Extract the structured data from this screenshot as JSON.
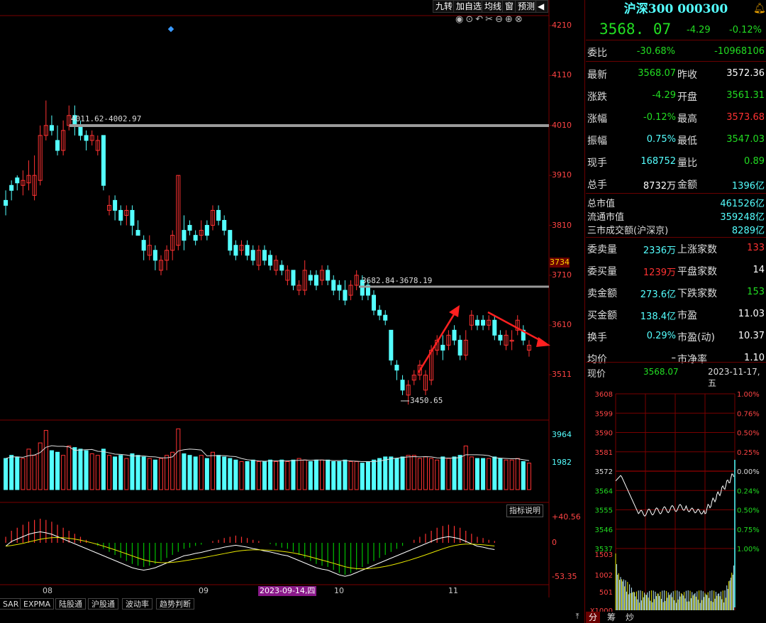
{
  "toolbar": {
    "buttons": [
      "九转",
      "加自选",
      "均线",
      "窗",
      "预测"
    ]
  },
  "colors": {
    "up": "#ff3232",
    "down": "#54ffff",
    "gray_line": "#9a9a9a",
    "yellow": "#e8e800",
    "white": "#ffffff",
    "green": "#00dd00",
    "cyan_text": "#54ffff",
    "grid": "#7a0000"
  },
  "kline": {
    "price_axis": [
      "4210",
      "4110",
      "4010",
      "3910",
      "3810",
      "3734",
      "3710",
      "3610",
      "3511"
    ],
    "current_price_tag": "3734",
    "annotations": {
      "range1": "4011.62-4002.97",
      "range2": "3682.84-3678.19",
      "low": "3450.65"
    },
    "volume_axis": [
      "3964",
      "1982"
    ],
    "macd_axis": [
      "+40.56",
      "0",
      "-53.35"
    ],
    "indicator_button": "指标说明",
    "date_labels": [
      "08",
      "09",
      "10",
      "11"
    ],
    "highlight_date": "2023-09-14,四",
    "bottom_tabs": [
      "SAR",
      "EXPMA",
      "陆股通",
      "沪股通",
      "波动率",
      "趋势判断"
    ]
  },
  "chart_data": {
    "type": "candlestick",
    "title": "沪深300 000300",
    "ylim": [
      3420,
      4230
    ],
    "candles": [
      {
        "o": 3860,
        "c": 3850,
        "h": 3880,
        "l": 3830
      },
      {
        "o": 3890,
        "c": 3880,
        "h": 3900,
        "l": 3860
      },
      {
        "o": 3905,
        "c": 3895,
        "h": 3910,
        "l": 3880
      },
      {
        "o": 3890,
        "c": 3900,
        "h": 3920,
        "l": 3870
      },
      {
        "o": 3895,
        "c": 3910,
        "h": 3940,
        "l": 3880
      },
      {
        "o": 3870,
        "c": 3910,
        "h": 3950,
        "l": 3860
      },
      {
        "o": 3900,
        "c": 3990,
        "h": 4010,
        "l": 3890
      },
      {
        "o": 3990,
        "c": 4010,
        "h": 4060,
        "l": 3980
      },
      {
        "o": 4010,
        "c": 4000,
        "h": 4030,
        "l": 3990
      },
      {
        "o": 3980,
        "c": 3960,
        "h": 4010,
        "l": 3950
      },
      {
        "o": 3960,
        "c": 4000,
        "h": 4020,
        "l": 3950
      },
      {
        "o": 4010,
        "c": 4030,
        "h": 4050,
        "l": 4000
      },
      {
        "o": 4030,
        "c": 4010,
        "h": 4050,
        "l": 3990
      },
      {
        "o": 4010,
        "c": 3990,
        "h": 4020,
        "l": 3980
      },
      {
        "o": 3990,
        "c": 3980,
        "h": 4000,
        "l": 3960
      },
      {
        "o": 3980,
        "c": 3990,
        "h": 4000,
        "l": 3970
      },
      {
        "o": 3960,
        "c": 3980,
        "h": 3990,
        "l": 3950
      },
      {
        "o": 3990,
        "c": 3890,
        "h": 3990,
        "l": 3880
      },
      {
        "o": 3840,
        "c": 3850,
        "h": 3870,
        "l": 3830
      },
      {
        "o": 3860,
        "c": 3840,
        "h": 3870,
        "l": 3820
      },
      {
        "o": 3840,
        "c": 3820,
        "h": 3850,
        "l": 3810
      },
      {
        "o": 3830,
        "c": 3840,
        "h": 3850,
        "l": 3810
      },
      {
        "o": 3840,
        "c": 3810,
        "h": 3850,
        "l": 3790
      },
      {
        "o": 3800,
        "c": 3790,
        "h": 3820,
        "l": 3790
      },
      {
        "o": 3780,
        "c": 3760,
        "h": 3790,
        "l": 3740
      },
      {
        "o": 3750,
        "c": 3770,
        "h": 3790,
        "l": 3740
      },
      {
        "o": 3760,
        "c": 3740,
        "h": 3770,
        "l": 3720
      },
      {
        "o": 3720,
        "c": 3740,
        "h": 3750,
        "l": 3710
      },
      {
        "o": 3740,
        "c": 3760,
        "h": 3770,
        "l": 3720
      },
      {
        "o": 3760,
        "c": 3790,
        "h": 3800,
        "l": 3740
      },
      {
        "o": 3770,
        "c": 3910,
        "h": 3910,
        "l": 3760
      },
      {
        "o": 3800,
        "c": 3780,
        "h": 3830,
        "l": 3760
      },
      {
        "o": 3810,
        "c": 3800,
        "h": 3820,
        "l": 3790
      },
      {
        "o": 3790,
        "c": 3780,
        "h": 3800,
        "l": 3770
      },
      {
        "o": 3790,
        "c": 3800,
        "h": 3820,
        "l": 3780
      },
      {
        "o": 3810,
        "c": 3790,
        "h": 3820,
        "l": 3780
      },
      {
        "o": 3810,
        "c": 3840,
        "h": 3850,
        "l": 3800
      },
      {
        "o": 3840,
        "c": 3820,
        "h": 3850,
        "l": 3810
      },
      {
        "o": 3820,
        "c": 3800,
        "h": 3830,
        "l": 3790
      },
      {
        "o": 3800,
        "c": 3760,
        "h": 3800,
        "l": 3750
      },
      {
        "o": 3770,
        "c": 3750,
        "h": 3780,
        "l": 3740
      },
      {
        "o": 3760,
        "c": 3770,
        "h": 3780,
        "l": 3750
      },
      {
        "o": 3770,
        "c": 3750,
        "h": 3780,
        "l": 3740
      },
      {
        "o": 3760,
        "c": 3740,
        "h": 3770,
        "l": 3730
      },
      {
        "o": 3730,
        "c": 3760,
        "h": 3770,
        "l": 3720
      },
      {
        "o": 3760,
        "c": 3740,
        "h": 3770,
        "l": 3730
      },
      {
        "o": 3750,
        "c": 3730,
        "h": 3760,
        "l": 3720
      },
      {
        "o": 3720,
        "c": 3740,
        "h": 3750,
        "l": 3710
      },
      {
        "o": 3730,
        "c": 3720,
        "h": 3740,
        "l": 3710
      },
      {
        "o": 3700,
        "c": 3720,
        "h": 3730,
        "l": 3690
      },
      {
        "o": 3720,
        "c": 3690,
        "h": 3720,
        "l": 3680
      },
      {
        "o": 3680,
        "c": 3690,
        "h": 3700,
        "l": 3670
      },
      {
        "o": 3680,
        "c": 3720,
        "h": 3740,
        "l": 3670
      },
      {
        "o": 3710,
        "c": 3700,
        "h": 3720,
        "l": 3690
      },
      {
        "o": 3710,
        "c": 3690,
        "h": 3720,
        "l": 3680
      },
      {
        "o": 3700,
        "c": 3720,
        "h": 3730,
        "l": 3690
      },
      {
        "o": 3720,
        "c": 3700,
        "h": 3730,
        "l": 3690
      },
      {
        "o": 3700,
        "c": 3680,
        "h": 3710,
        "l": 3670
      },
      {
        "o": 3690,
        "c": 3680,
        "h": 3700,
        "l": 3660
      },
      {
        "o": 3680,
        "c": 3660,
        "h": 3700,
        "l": 3650
      },
      {
        "o": 3670,
        "c": 3690,
        "h": 3700,
        "l": 3660
      },
      {
        "o": 3690,
        "c": 3710,
        "h": 3720,
        "l": 3680
      },
      {
        "o": 3700,
        "c": 3670,
        "h": 3710,
        "l": 3660
      },
      {
        "o": 3690,
        "c": 3670,
        "h": 3700,
        "l": 3660
      },
      {
        "o": 3670,
        "c": 3640,
        "h": 3680,
        "l": 3630
      },
      {
        "o": 3640,
        "c": 3630,
        "h": 3650,
        "l": 3620
      },
      {
        "o": 3630,
        "c": 3620,
        "h": 3640,
        "l": 3610
      },
      {
        "o": 3600,
        "c": 3540,
        "h": 3600,
        "l": 3530
      },
      {
        "o": 3530,
        "c": 3520,
        "h": 3540,
        "l": 3500
      },
      {
        "o": 3500,
        "c": 3480,
        "h": 3510,
        "l": 3470
      },
      {
        "o": 3470,
        "c": 3490,
        "h": 3500,
        "l": 3451
      },
      {
        "o": 3500,
        "c": 3510,
        "h": 3520,
        "l": 3490
      },
      {
        "o": 3510,
        "c": 3530,
        "h": 3540,
        "l": 3500
      },
      {
        "o": 3480,
        "c": 3510,
        "h": 3520,
        "l": 3470
      },
      {
        "o": 3500,
        "c": 3560,
        "h": 3570,
        "l": 3490
      },
      {
        "o": 3560,
        "c": 3580,
        "h": 3590,
        "l": 3550
      },
      {
        "o": 3570,
        "c": 3560,
        "h": 3590,
        "l": 3540
      },
      {
        "o": 3570,
        "c": 3590,
        "h": 3600,
        "l": 3560
      },
      {
        "o": 3600,
        "c": 3580,
        "h": 3610,
        "l": 3570
      },
      {
        "o": 3580,
        "c": 3550,
        "h": 3590,
        "l": 3540
      },
      {
        "o": 3550,
        "c": 3580,
        "h": 3600,
        "l": 3540
      },
      {
        "o": 3610,
        "c": 3630,
        "h": 3640,
        "l": 3600
      },
      {
        "o": 3620,
        "c": 3610,
        "h": 3630,
        "l": 3600
      },
      {
        "o": 3620,
        "c": 3610,
        "h": 3630,
        "l": 3600
      },
      {
        "o": 3610,
        "c": 3620,
        "h": 3630,
        "l": 3600
      },
      {
        "o": 3620,
        "c": 3590,
        "h": 3630,
        "l": 3580
      },
      {
        "o": 3590,
        "c": 3580,
        "h": 3600,
        "l": 3570
      },
      {
        "o": 3570,
        "c": 3590,
        "h": 3600,
        "l": 3560
      },
      {
        "o": 3580,
        "c": 3580,
        "h": 3600,
        "l": 3560
      },
      {
        "o": 3600,
        "c": 3620,
        "h": 3630,
        "l": 3590
      },
      {
        "o": 3600,
        "c": 3580,
        "h": 3610,
        "l": 3570
      },
      {
        "o": 3560,
        "c": 3570,
        "h": 3580,
        "l": 3547
      }
    ],
    "volumes": [
      2000,
      2200,
      2100,
      2000,
      2600,
      2200,
      3000,
      3800,
      2500,
      2400,
      2200,
      2800,
      2700,
      2600,
      2500,
      2300,
      2200,
      2600,
      2200,
      2100,
      2200,
      2000,
      2300,
      2200,
      2100,
      2000,
      1900,
      2000,
      2200,
      2400,
      3900,
      2300,
      2200,
      2100,
      2200,
      2000,
      2400,
      2200,
      2100,
      2000,
      1900,
      1800,
      1800,
      1900,
      1800,
      1800,
      1900,
      1800,
      1900,
      1800,
      1900,
      2000,
      1900,
      1800,
      1900,
      1900,
      1900,
      1800,
      1800,
      1900,
      1800,
      1800,
      1700,
      1800,
      1900,
      2000,
      2100,
      2100,
      2000,
      2100,
      2200,
      2200,
      2000,
      2100,
      2000,
      1900,
      2100,
      2000,
      2100,
      2200,
      2800,
      2100,
      2000,
      2000,
      2000,
      2100,
      2000,
      1900,
      1900,
      2000,
      1800,
      1700
    ],
    "macd_hist": [
      10,
      20,
      25,
      30,
      35,
      38,
      40,
      38,
      35,
      30,
      25,
      20,
      15,
      10,
      5,
      0,
      -5,
      -10,
      -15,
      -20,
      -25,
      -30,
      -35,
      -38,
      -40,
      -38,
      -35,
      -30,
      -25,
      -20,
      -15,
      -10,
      -8,
      -5,
      -3,
      0,
      3,
      5,
      8,
      10,
      12,
      10,
      8,
      5,
      3,
      0,
      -2,
      -5,
      -8,
      -10,
      -15,
      -20,
      -25,
      -30,
      -35,
      -38,
      -40,
      -45,
      -50,
      -53,
      -50,
      -45,
      -40,
      -35,
      -30,
      -25,
      -20,
      -15,
      -10,
      -5,
      0,
      5,
      10,
      15,
      20,
      25,
      28,
      30,
      28,
      25,
      20,
      15,
      10,
      8,
      5,
      3
    ],
    "current_price": "3568.07",
    "prev_close": "3572.36"
  },
  "right_panel": {
    "title": "沪深300 000300",
    "price": "3568. 07",
    "change": "-4.29",
    "change_pct": "-0.12%",
    "weibi_label": "委比",
    "weibi_pct": "-30.68%",
    "weibi_val": "-10968106",
    "rows": [
      {
        "l1": "最新",
        "v1": "3568.07",
        "c1": "green",
        "l2": "昨收",
        "v2": "3572.36",
        "c2": "white"
      },
      {
        "l1": "涨跌",
        "v1": "-4.29",
        "c1": "green",
        "l2": "开盘",
        "v2": "3561.31",
        "c2": "green"
      },
      {
        "l1": "涨幅",
        "v1": "-0.12%",
        "c1": "green",
        "l2": "最高",
        "v2": "3573.68",
        "c2": "red"
      },
      {
        "l1": "振幅",
        "v1": "0.75%",
        "c1": "cyan",
        "l2": "最低",
        "v2": "3547.03",
        "c2": "green"
      },
      {
        "l1": "现手",
        "v1": "168752",
        "c1": "cyan",
        "l2": "量比",
        "v2": "0.89",
        "c2": "green"
      },
      {
        "l1": "总手",
        "v1": "8732万",
        "c1": "white",
        "l2": "金额",
        "v2": "1396亿",
        "c2": "cyan"
      }
    ],
    "market": [
      {
        "label": "总市值",
        "value": "461526亿"
      },
      {
        "label": "流通市值",
        "value": "359248亿"
      },
      {
        "label": "三市成交额(沪深京)",
        "value": "8289亿"
      }
    ],
    "rows2": [
      {
        "l1": "委卖量",
        "v1": "2336万",
        "c1": "cyan",
        "l2": "上涨家数",
        "v2": "133",
        "c2": "red"
      },
      {
        "l1": "委买量",
        "v1": "1239万",
        "c1": "red",
        "l2": "平盘家数",
        "v2": "14",
        "c2": "white"
      },
      {
        "l1": "卖金额",
        "v1": "273.6亿",
        "c1": "cyan",
        "l2": "下跌家数",
        "v2": "153",
        "c2": "green"
      },
      {
        "l1": "买金额",
        "v1": "138.4亿",
        "c1": "cyan",
        "l2": "市盈",
        "v2": "11.03",
        "c2": "white"
      },
      {
        "l1": "换手",
        "v1": "0.29%",
        "c1": "cyan",
        "l2": "市盈(动)",
        "v2": "10.37",
        "c2": "white"
      },
      {
        "l1": "均价",
        "v1": "–",
        "c1": "white",
        "l2": "市净率",
        "v2": "1.10",
        "c2": "white"
      }
    ],
    "now_label": "现价",
    "now_price": "3568.07",
    "date": "2023-11-17,五",
    "mini_left_axis": [
      "3608",
      "3599",
      "3590",
      "3581",
      "3572",
      "3564",
      "3555",
      "3546",
      "3537"
    ],
    "mini_right_axis": [
      "1.00%",
      "0.76%",
      "0.50%",
      "0.25%",
      "0.00%",
      "0.24%",
      "0.50%",
      "0.75%",
      "1.00%"
    ],
    "mini_vol_axis": [
      "1503",
      "1002",
      "501",
      "X1000"
    ],
    "bottom_tabs": [
      "分",
      "筹",
      "炒"
    ]
  }
}
